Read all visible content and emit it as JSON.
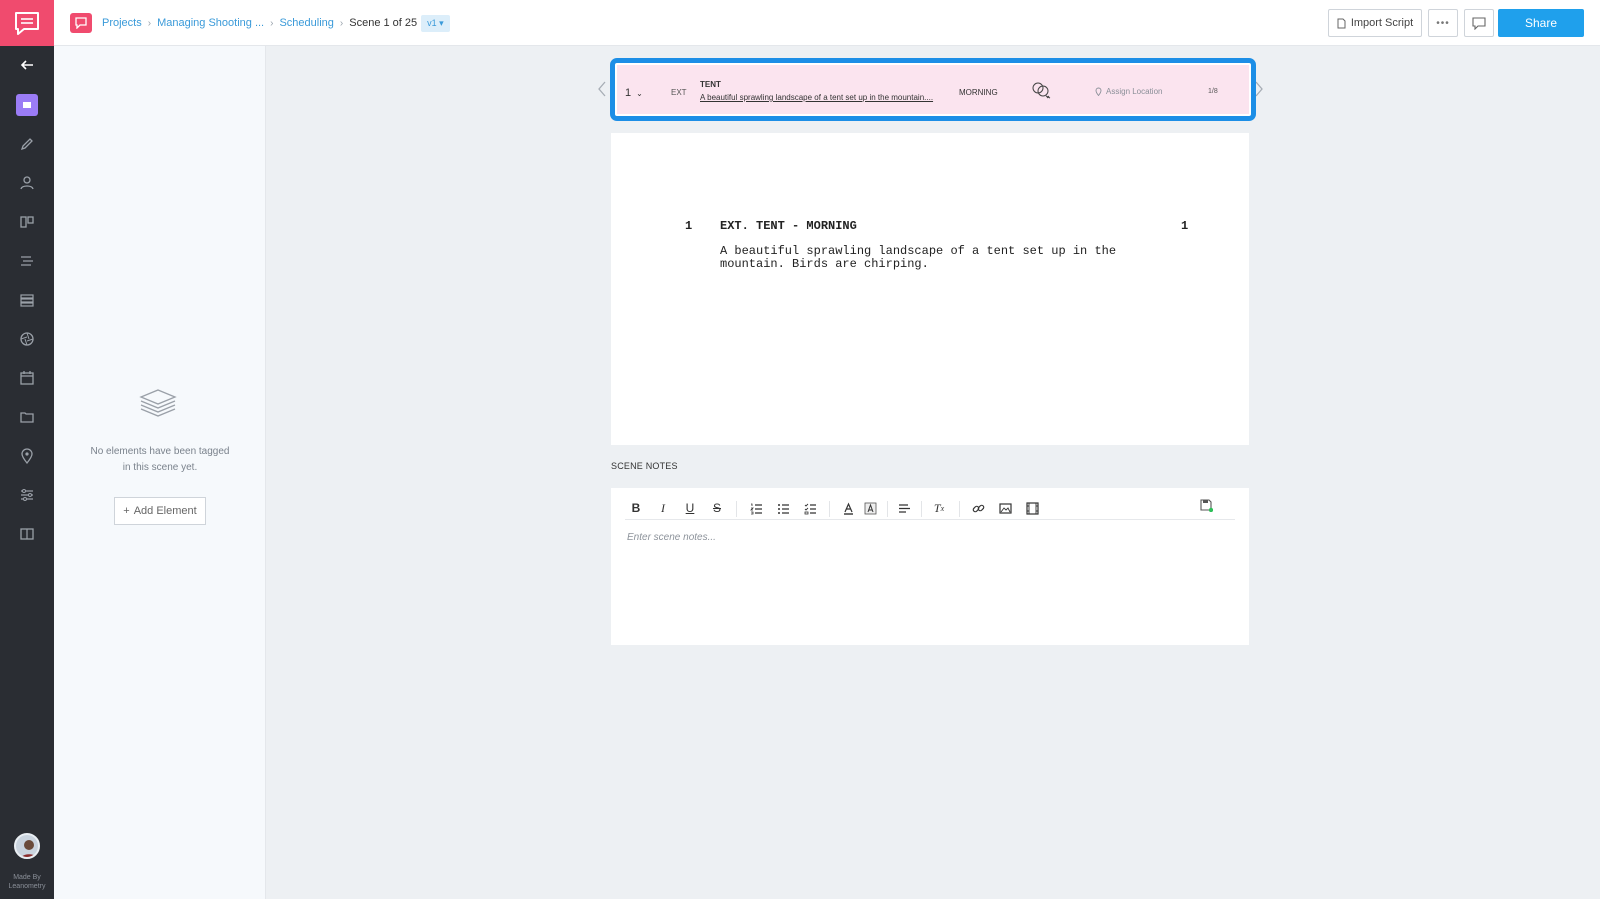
{
  "header": {
    "breadcrumbs": [
      "Projects",
      "Managing Shooting ...",
      "Scheduling"
    ],
    "current": "Scene 1 of 25",
    "version": "v1",
    "import_label": "Import Script",
    "more_label": "•••",
    "share_label": "Share"
  },
  "rail": {
    "made_by_line1": "Made By",
    "made_by_line2": "Leanometry",
    "icons": [
      "back-arrow-icon",
      "scene-icon",
      "pencil-icon",
      "cast-icon",
      "storyboard-icon",
      "breakdown-icon",
      "stripboard-icon",
      "camera-aperture-icon",
      "calendar-icon",
      "folder-icon",
      "location-pin-icon",
      "sliders-icon",
      "book-icon"
    ]
  },
  "elements_panel": {
    "empty_line1": "No elements have been tagged",
    "empty_line2": "in this scene yet.",
    "add_label": "Add Element"
  },
  "strip": {
    "scene_number": "1",
    "int_ext": "EXT",
    "set": "TENT",
    "description": "A beautiful sprawling landscape of a tent set up in the mountain....",
    "time": "MORNING",
    "location_label": "Assign Location",
    "pages": "1/8",
    "color": "#fbe4ef"
  },
  "script": {
    "scene_number": "1",
    "heading": "EXT. TENT - MORNING",
    "action": [
      "A beautiful sprawling landscape of a tent set up in the",
      "mountain. Birds are chirping."
    ]
  },
  "notes": {
    "label": "SCENE NOTES",
    "placeholder": "Enter scene notes...",
    "toolbar": [
      "bold-icon",
      "italic-icon",
      "underline-icon",
      "strikethrough-icon",
      "ordered-list-icon",
      "bullet-list-icon",
      "checklist-icon",
      "text-color-icon",
      "highlight-icon",
      "align-icon",
      "clear-format-icon",
      "link-icon",
      "image-icon",
      "video-icon",
      "save-icon"
    ]
  },
  "colors": {
    "brand": "#f04b6e",
    "accent": "#1fa0ec",
    "highlight_border": "#1c8ee6",
    "rail": "#2a2d33"
  }
}
